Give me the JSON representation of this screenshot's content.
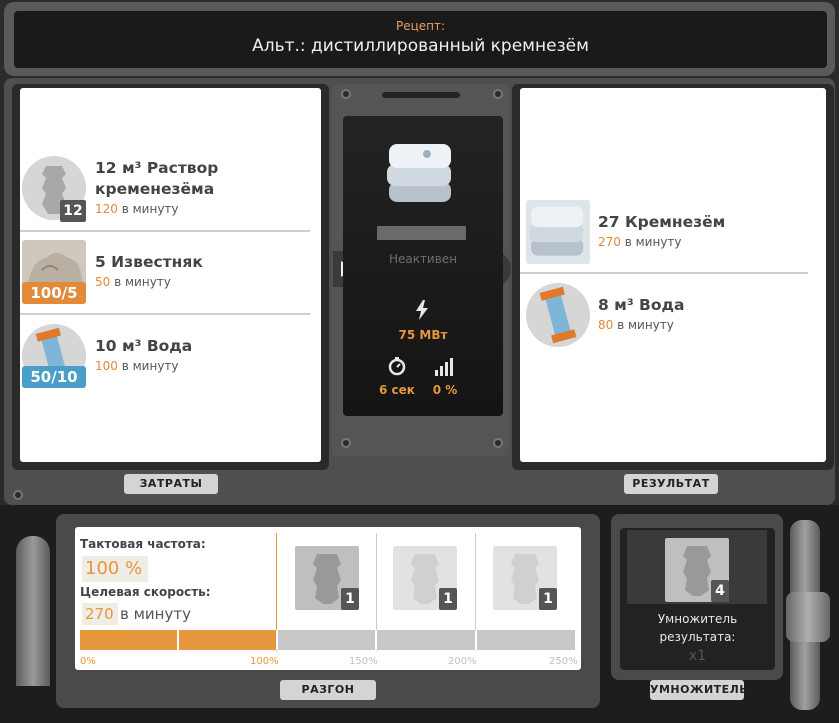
{
  "header": {
    "subtitle": "Рецепт:",
    "title": "Альт.: дистиллированный кремнезём"
  },
  "inputs": {
    "tab_label": "ЗАТРАТЫ",
    "items": [
      {
        "name": "12 м³ Раствор кременезёма",
        "rate": "120",
        "rate_unit": "в минуту",
        "count": "12",
        "icon": "silica-solution-canister-icon"
      },
      {
        "name": "5 Известняк",
        "rate": "50",
        "rate_unit": "в минуту",
        "badge": "100/5",
        "badge_color": "#e08a3a",
        "icon": "limestone-icon"
      },
      {
        "name": "10 м³ Вода",
        "rate": "100",
        "rate_unit": "в минуту",
        "badge": "50/10",
        "badge_color": "#4a9fc8",
        "icon": "water-canister-icon"
      }
    ]
  },
  "center": {
    "status": "Неактивен",
    "power": "75 МВт",
    "cycle_time": "6 сек",
    "productivity": "0 %",
    "icons": {
      "product": "silica-bags-icon",
      "power": "lightning-icon",
      "time": "stopwatch-icon",
      "productivity": "bar-chart-icon"
    }
  },
  "outputs": {
    "tab_label": "РЕЗУЛЬТАТ",
    "items": [
      {
        "name": "27 Кремнезём",
        "rate": "270",
        "rate_unit": "в минуту",
        "icon": "silica-bags-icon"
      },
      {
        "name": "8 м³ Вода",
        "rate": "80",
        "rate_unit": "в минуту",
        "icon": "water-canister-icon"
      }
    ]
  },
  "overclock": {
    "tab_label": "РАЗГОН",
    "clock_label": "Тактовая частота:",
    "clock_value": "100 %",
    "target_label": "Целевая скорость:",
    "target_value": "270",
    "target_unit": "в минуту",
    "clock_fraction": 0.4,
    "slots": [
      {
        "count": "1",
        "active": true
      },
      {
        "count": "1",
        "active": false
      },
      {
        "count": "1",
        "active": false
      }
    ],
    "scale": [
      "0%",
      "100%",
      "150%",
      "200%",
      "250%"
    ],
    "colors": {
      "fill": "#e8963c",
      "track": "#c8c8c8"
    }
  },
  "multiplier": {
    "tab_label": "УМНОЖИТЕЛЬ",
    "count": "4",
    "label": "Умножитель результата:",
    "value": "x1"
  }
}
